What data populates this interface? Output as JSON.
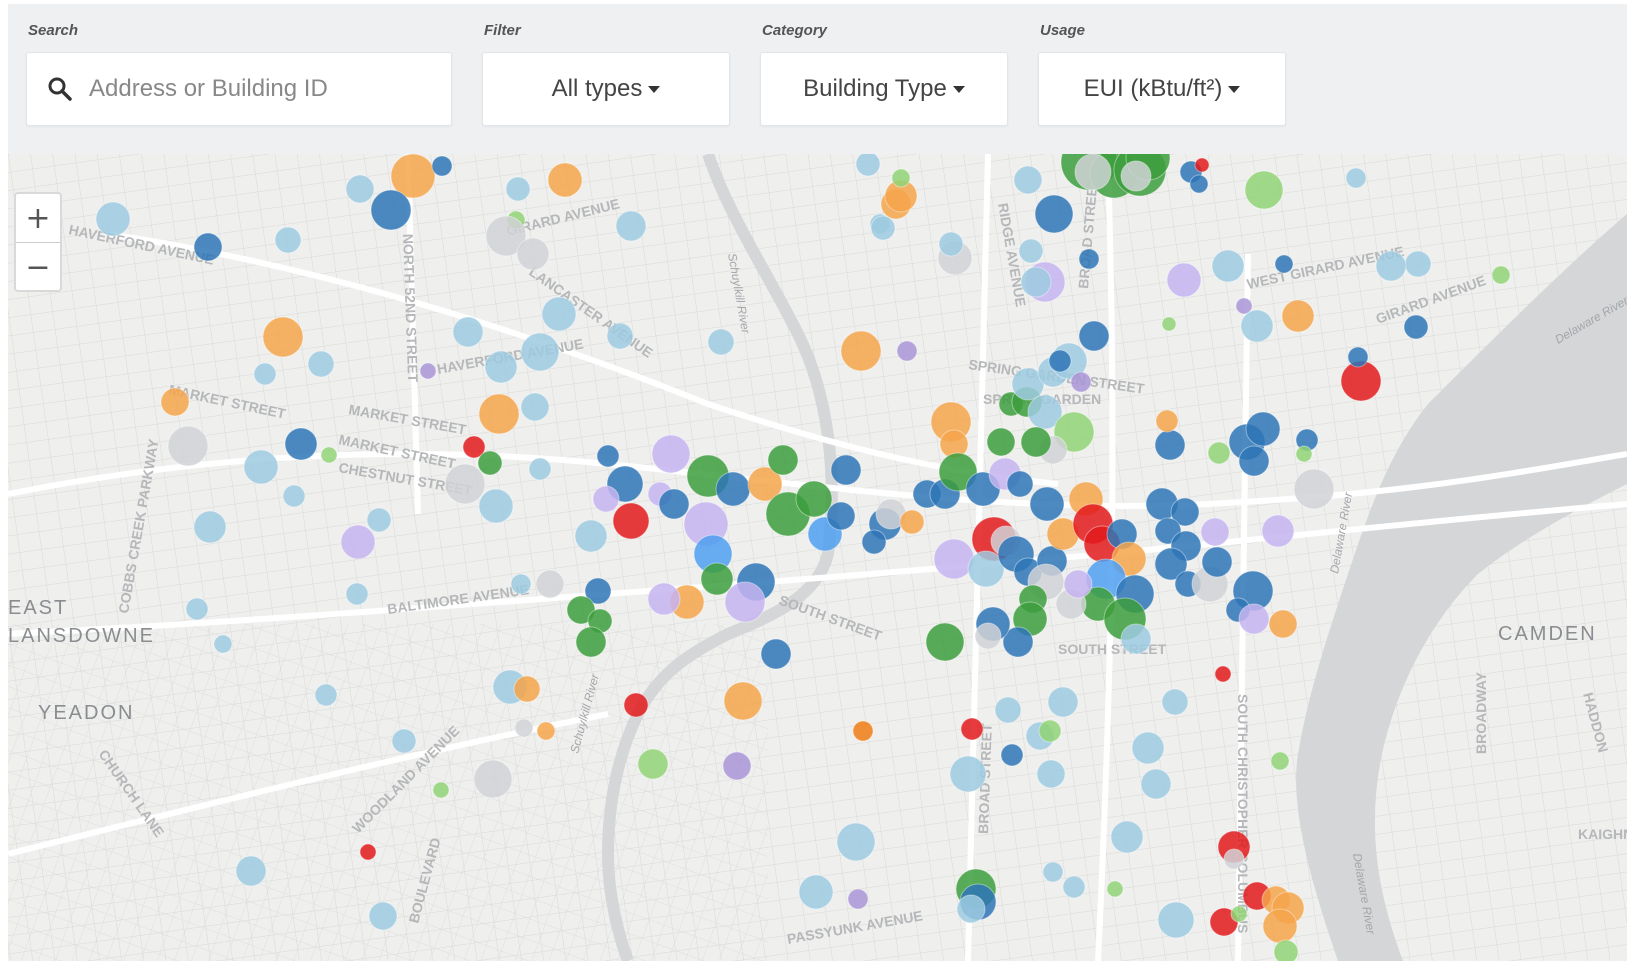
{
  "toolbar": {
    "search": {
      "label": "Search",
      "placeholder": "Address or Building ID",
      "value": ""
    },
    "filter": {
      "label": "Filter",
      "value": "All types"
    },
    "category": {
      "label": "Category",
      "value": "Building Type"
    },
    "usage": {
      "label": "Usage",
      "value": "EUI (kBtu/ft²)"
    }
  },
  "map": {
    "zoom_in": "+",
    "zoom_out": "−",
    "place_labels": [
      "EAST",
      "LANSDOWNE",
      "YEADON",
      "CAMDEN"
    ],
    "street_labels": [
      "HAVERFORD AVENUE",
      "MARKET STREET",
      "MARKET STREET",
      "MARKET STREET",
      "CHESTNUT STREET",
      "NORTH 52ND STREET",
      "GIRARD AVENUE",
      "LANCASTER AVENUE",
      "HAVERFORD AVENUE",
      "BALTIMORE AVENUE",
      "SOUTH STREET",
      "WOODLAND AVENUE",
      "CHURCH LANE",
      "COBBS CREEK PARKWAY",
      "SPRING GARDEN STREET",
      "BROAD STREET",
      "WEST GIRARD AVENUE",
      "GIRARD AVENUE",
      "SOUTH CHRISTOPHER COLUMBUS",
      "BROAD STREET",
      "PASSYUNK AVENUE",
      "BROADWAY",
      "HADDON",
      "KAIGHN",
      "RIDGE AVENUE",
      "SPRING GARDEN",
      "SOUTH STREET",
      "BOULEVARD"
    ],
    "water_labels": [
      "Delaware River",
      "Delaware River",
      "Schuylkill River",
      "Schuylkill River",
      "Delaware River"
    ],
    "building_type_colors": {
      "office": "#2e75b6",
      "multifamily": "#9ecae1",
      "education": "#3c9e3c",
      "healthcare": "#e31a1c",
      "retail": "#f5a54a",
      "warehouse": "#c6b4f0",
      "lodging": "#d0d2d6",
      "worship": "#a994d6",
      "other": "#90d476",
      "public": "#4f9ff0"
    }
  }
}
